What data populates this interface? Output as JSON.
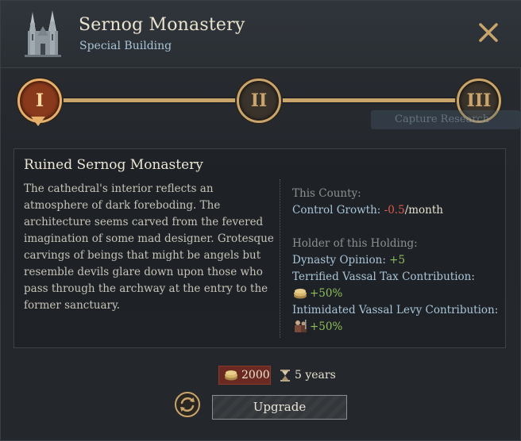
{
  "header": {
    "title": "Sernog Monastery",
    "subtitle": "Special Building",
    "icon": "cathedral-icon",
    "close_icon": "close-icon"
  },
  "tiers": [
    {
      "numeral": "I",
      "active": true
    },
    {
      "numeral": "II",
      "active": false
    },
    {
      "numeral": "III",
      "active": false
    }
  ],
  "background_tooltip": "Capture Research",
  "detail": {
    "title": "Ruined Sernog Monastery",
    "description": "The cathedral's interior reflects an atmosphere of dark foreboding. The architecture seems carved from the fevered imagination of some mad designer. Grotesque carvings of beings that might be angels but resemble devils glare down upon those who pass through the archway at the entry to the former sanctuary.",
    "county": {
      "header": "This County:",
      "label": "Control Growth: ",
      "value": "-0.5",
      "unit": "/month"
    },
    "holder": {
      "header": "Holder of this Holding:",
      "dynasty_label": "Dynasty Opinion: ",
      "dynasty_value": "+5",
      "tax_label": "Terrified Vassal Tax Contribution:",
      "tax_value": "+50%",
      "levy_label": "Intimidated Vassal Levy Contribution:",
      "levy_value": "+50%"
    }
  },
  "footer": {
    "cost": "2000",
    "time": "5 years",
    "upgrade_label": "Upgrade"
  },
  "colors": {
    "gold": "#c9a56b",
    "active_tier": "#8a3a1c",
    "negative": "#e05a4a",
    "positive": "#8fbf5a",
    "label_blue": "#a9c4d8"
  }
}
